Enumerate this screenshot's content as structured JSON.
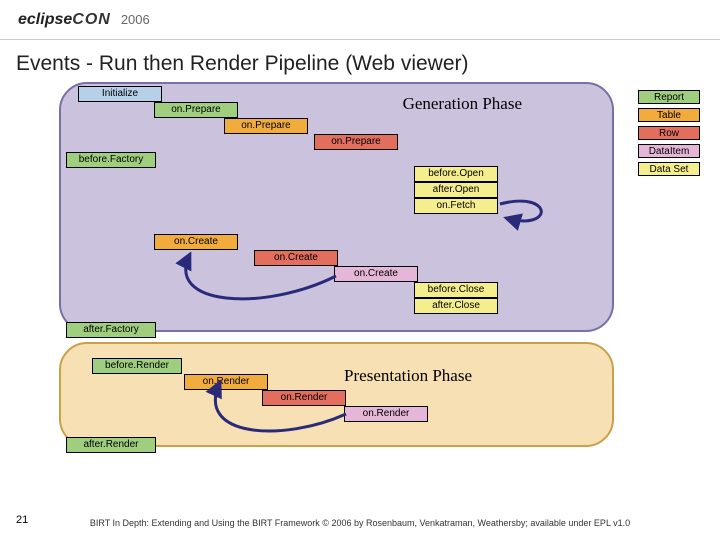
{
  "header": {
    "brand_left": "eclipse",
    "brand_right": "CON",
    "year": "2006"
  },
  "title": "Events - Run then Render Pipeline (Web viewer)",
  "phases": {
    "generation": "Generation Phase",
    "presentation": "Presentation Phase"
  },
  "legend": [
    {
      "label": "Report",
      "color": "c-green"
    },
    {
      "label": "Table",
      "color": "c-orange"
    },
    {
      "label": "Row",
      "color": "c-red"
    },
    {
      "label": "DataItem",
      "color": "c-pink"
    },
    {
      "label": "Data Set",
      "color": "c-yellow"
    }
  ],
  "nodes": {
    "initialize": {
      "label": "Initialize",
      "color": "c-blue"
    },
    "onPrepare1": {
      "label": "on.Prepare",
      "color": "c-green"
    },
    "onPrepare2": {
      "label": "on.Prepare",
      "color": "c-orange"
    },
    "onPrepare3": {
      "label": "on.Prepare",
      "color": "c-red"
    },
    "beforeFactory": {
      "label": "before.Factory",
      "color": "c-green"
    },
    "beforeOpen": {
      "label": "before.Open",
      "color": "c-yellow"
    },
    "afterOpen": {
      "label": "after.Open",
      "color": "c-yellow"
    },
    "onFetch": {
      "label": "on.Fetch",
      "color": "c-yellow"
    },
    "onCreate1": {
      "label": "on.Create",
      "color": "c-orange"
    },
    "onCreate2": {
      "label": "on.Create",
      "color": "c-red"
    },
    "onCreate3": {
      "label": "on.Create",
      "color": "c-pink"
    },
    "beforeClose": {
      "label": "before.Close",
      "color": "c-yellow"
    },
    "afterClose": {
      "label": "after.Close",
      "color": "c-yellow"
    },
    "afterFactory": {
      "label": "after.Factory",
      "color": "c-green"
    },
    "beforeRender": {
      "label": "before.Render",
      "color": "c-green"
    },
    "onRender1": {
      "label": "on.Render",
      "color": "c-orange"
    },
    "onRender2": {
      "label": "on.Render",
      "color": "c-red"
    },
    "onRender3": {
      "label": "on.Render",
      "color": "c-pink"
    },
    "afterRender": {
      "label": "after.Render",
      "color": "c-green"
    }
  },
  "footer": {
    "page": "21",
    "text": "BIRT In Depth: Extending and Using the BIRT Framework © 2006 by Rosenbaum, Venkatraman, Weathersby; available under EPL v1.0"
  }
}
